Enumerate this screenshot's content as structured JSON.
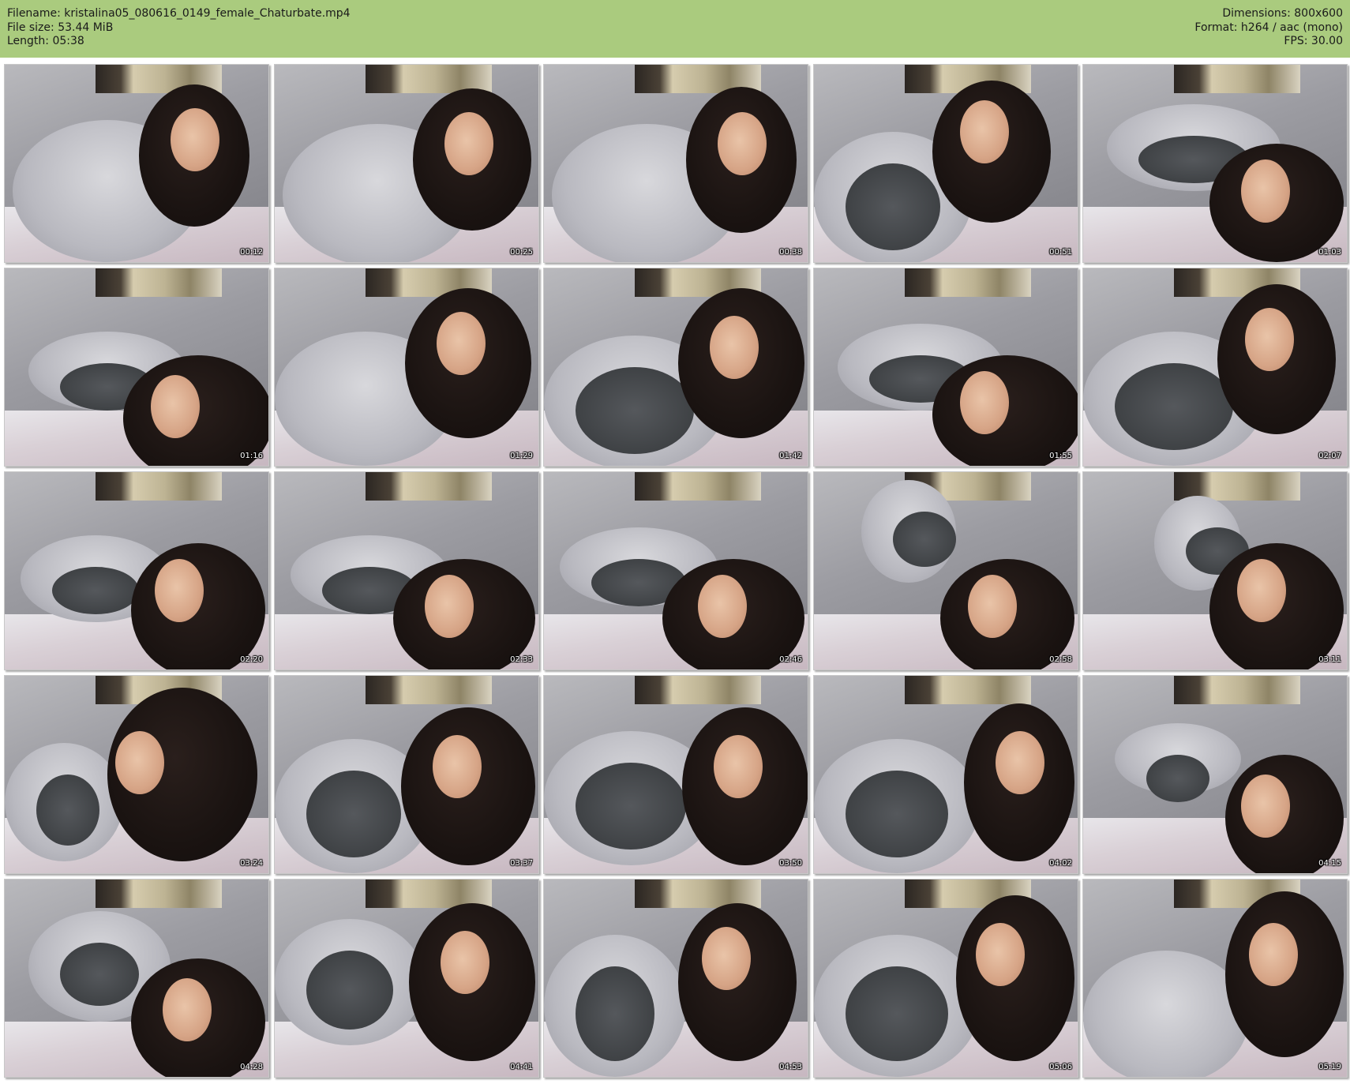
{
  "header": {
    "filename_line": "Filename: kristalina05_080616_0149_female_Chaturbate.mp4",
    "filesize_line": "File size: 53.44 MiB",
    "length_line": "Length: 05:38",
    "dimensions_line": "Dimensions: 800x600",
    "format_line": "Format: h264 / aac (mono)",
    "fps_line": "FPS: 30.00",
    "background_color": "#aacb7e"
  },
  "thumbnails": [
    {
      "timestamp": "00:12"
    },
    {
      "timestamp": "00:25"
    },
    {
      "timestamp": "00:38"
    },
    {
      "timestamp": "00:51"
    },
    {
      "timestamp": "01:03"
    },
    {
      "timestamp": "01:16"
    },
    {
      "timestamp": "01:29"
    },
    {
      "timestamp": "01:42"
    },
    {
      "timestamp": "01:55"
    },
    {
      "timestamp": "02:07"
    },
    {
      "timestamp": "02:20"
    },
    {
      "timestamp": "02:33"
    },
    {
      "timestamp": "02:46"
    },
    {
      "timestamp": "02:58"
    },
    {
      "timestamp": "03:11"
    },
    {
      "timestamp": "03:24"
    },
    {
      "timestamp": "03:37"
    },
    {
      "timestamp": "03:50"
    },
    {
      "timestamp": "04:02"
    },
    {
      "timestamp": "04:15"
    },
    {
      "timestamp": "04:28"
    },
    {
      "timestamp": "04:41"
    },
    {
      "timestamp": "04:53"
    },
    {
      "timestamp": "05:06"
    },
    {
      "timestamp": "05:19"
    }
  ]
}
